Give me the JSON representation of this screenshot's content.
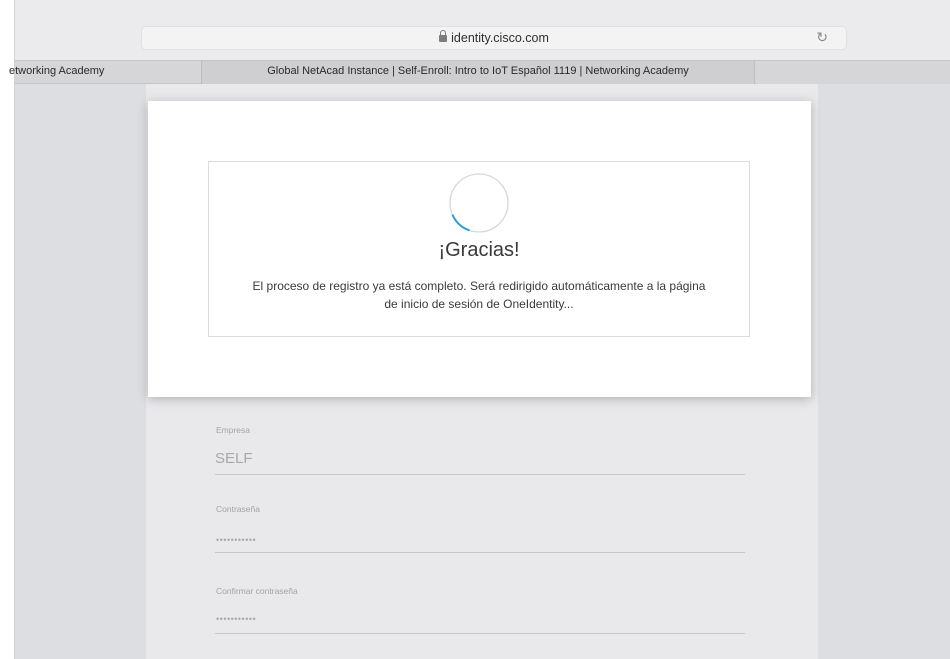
{
  "browser": {
    "url": "identity.cisco.com",
    "tabs": [
      {
        "label": "etworking Academy"
      },
      {
        "label": "Global NetAcad Instance | Self-Enroll: Intro to IoT Español 1119 | Networking Academy"
      }
    ]
  },
  "modal": {
    "title": "¡Gracias!",
    "message_line1": "El proceso de registro ya está completo. Será redirigido automáticamente a la página",
    "message_line2": "de inicio de sesión de OneIdentity..."
  },
  "form": {
    "company_label": "Empresa",
    "company_value": "SELF",
    "password_label": "Contraseña",
    "password_value": "•••••••••••",
    "confirm_label": "Confirmar contraseña",
    "confirm_value": "•••••••••••"
  },
  "colors": {
    "spinner_accent": "#2e9fd4",
    "spinner_track": "#d8d8db"
  }
}
